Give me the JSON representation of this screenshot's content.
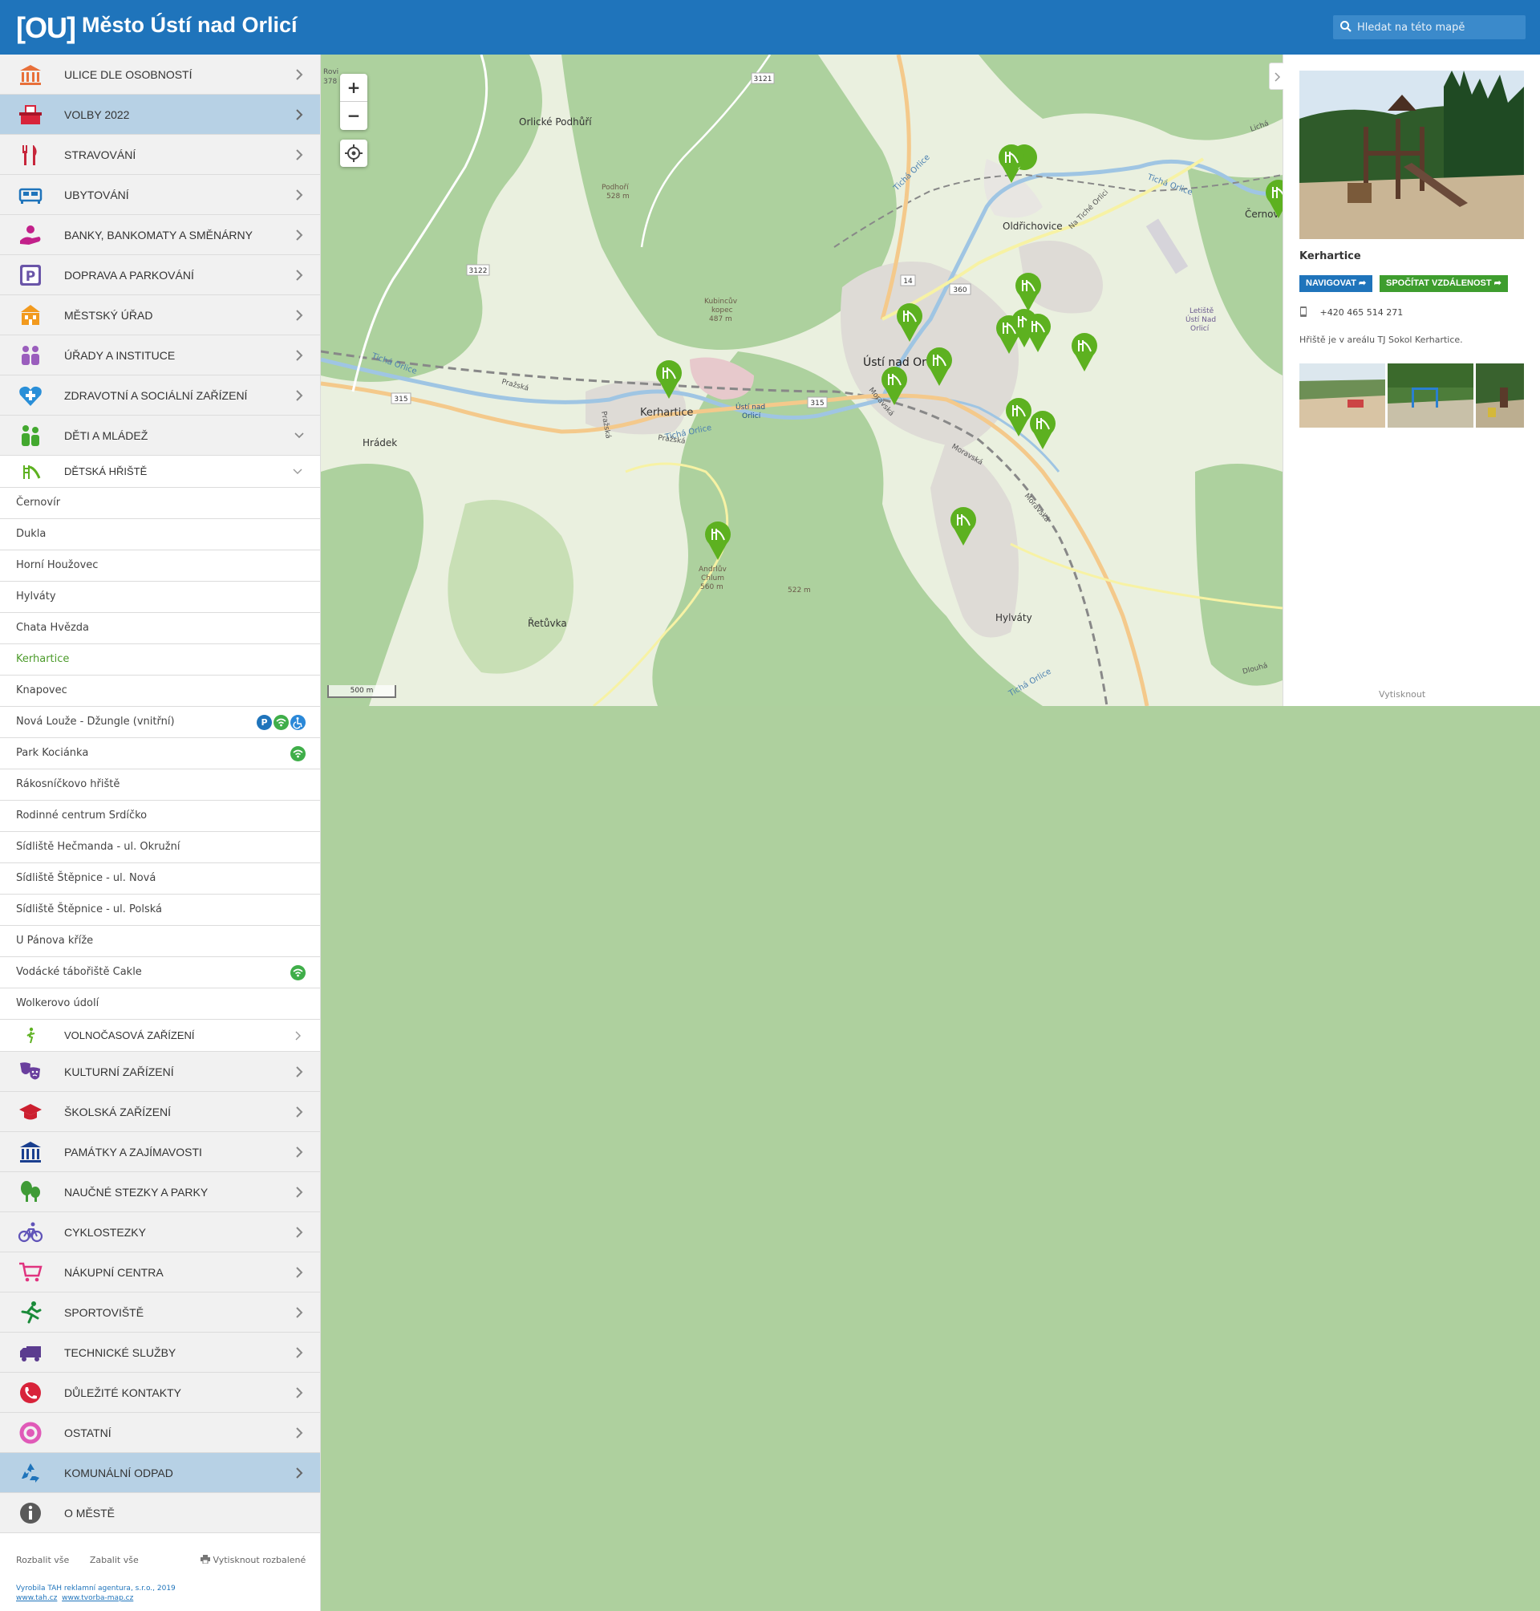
{
  "header": {
    "logo": "[OU]",
    "title": "Město Ústí nad Orlicí",
    "search_placeholder": "Hledat na této mapě"
  },
  "sidebar": {
    "categories_top": [
      {
        "label": "ULICE DLE OSOBNOSTÍ",
        "icon": "monument-icon"
      },
      {
        "label": "VOLBY 2022",
        "icon": "ballot-box-icon"
      },
      {
        "label": "STRAVOVÁNÍ",
        "icon": "fork-knife-icon"
      },
      {
        "label": "UBYTOVÁNÍ",
        "icon": "bed-icon"
      },
      {
        "label": "BANKY, BANKOMATY A SMĚNÁRNY",
        "icon": "coin-hand-icon"
      },
      {
        "label": "DOPRAVA A PARKOVÁNÍ",
        "icon": "parking-icon"
      },
      {
        "label": "MĚSTSKÝ ÚŘAD",
        "icon": "town-hall-icon"
      },
      {
        "label": "ÚŘADY A INSTITUCE",
        "icon": "people-icon"
      },
      {
        "label": "ZDRAVOTNÍ A SOCIÁLNÍ ZAŘÍZENÍ",
        "icon": "heart-cross-icon"
      },
      {
        "label": "DĚTI A MLÁDEŽ",
        "icon": "children-icon"
      }
    ],
    "subcategory": {
      "label": "DĚTSKÁ HŘIŠTĚ",
      "icon": "slide-icon"
    },
    "items": [
      {
        "label": "Černovír"
      },
      {
        "label": "Dukla"
      },
      {
        "label": "Horní Houžovec"
      },
      {
        "label": "Hylváty"
      },
      {
        "label": "Chata Hvězda"
      },
      {
        "label": "Kerhartice"
      },
      {
        "label": "Knapovec"
      },
      {
        "label": "Nová Louže - Džungle (vnitřní)"
      },
      {
        "label": "Park Kociánka"
      },
      {
        "label": "Rákosníčkovo hřiště"
      },
      {
        "label": "Rodinné centrum Srdíčko"
      },
      {
        "label": "Sídliště Hečmanda - ul. Okružní"
      },
      {
        "label": "Sídliště Štěpnice - ul. Nová"
      },
      {
        "label": "Sídliště Štěpnice - ul. Polská"
      },
      {
        "label": "U Pánova kříže"
      },
      {
        "label": "Vodácké tábořiště Cakle"
      },
      {
        "label": "Wolkerovo údolí"
      }
    ],
    "subcategory2": {
      "label": "VOLNOČASOVÁ ZAŘÍZENÍ",
      "icon": "leisure-icon"
    },
    "categories_bottom": [
      {
        "label": "KULTURNÍ ZAŘÍZENÍ",
        "icon": "theater-masks-icon"
      },
      {
        "label": "ŠKOLSKÁ ZAŘÍZENÍ",
        "icon": "graduation-cap-icon"
      },
      {
        "label": "PAMÁTKY A ZAJÍMAVOSTI",
        "icon": "columns-icon"
      },
      {
        "label": "NAUČNÉ STEZKY A PARKY",
        "icon": "trees-icon"
      },
      {
        "label": "CYKLOSTEZKY",
        "icon": "bicycle-icon"
      },
      {
        "label": "NÁKUPNÍ CENTRA",
        "icon": "shopping-cart-icon"
      },
      {
        "label": "SPORTOVIŠTĚ",
        "icon": "runner-icon"
      },
      {
        "label": "TECHNICKÉ SLUŽBY",
        "icon": "truck-icon"
      },
      {
        "label": "DŮLEŽITÉ KONTAKTY",
        "icon": "phone-icon"
      },
      {
        "label": "OSTATNÍ",
        "icon": "circle-icon"
      },
      {
        "label": "KOMUNÁLNÍ ODPAD",
        "icon": "recycle-icon"
      },
      {
        "label": "O MĚSTĚ",
        "icon": "info-icon"
      }
    ],
    "footer": {
      "expand_all": "Rozbalit vše",
      "collapse_all": "Zabalit vše",
      "print_expanded": "Vytisknout rozbalené",
      "credit_line1": "Vyrobila TAH reklamní agentura, s.r.o., 2019",
      "credit_link1": "www.tah.cz",
      "credit_link2": "www.tvorba-map.cz"
    }
  },
  "map": {
    "labels": [
      {
        "text": "Orlické Podhůří"
      },
      {
        "text": "Oldřichovice"
      },
      {
        "text": "Kerhartice"
      },
      {
        "text": "Ústí nad Or"
      },
      {
        "text": "Hrádek"
      },
      {
        "text": "Řetůvka"
      },
      {
        "text": "Hylváty"
      },
      {
        "text": "Černov"
      },
      {
        "text": "Podhoří"
      },
      {
        "text": "528 m"
      },
      {
        "text": "Kubincův"
      },
      {
        "text": "kopec"
      },
      {
        "text": "487 m"
      },
      {
        "text": "Andrlův"
      },
      {
        "text": "Chlum"
      },
      {
        "text": "560 m"
      },
      {
        "text": "522 m"
      },
      {
        "text": "Ústí nad"
      },
      {
        "text": "Orlicí"
      },
      {
        "text": "Letiště"
      },
      {
        "text": "Ústí Nad"
      },
      {
        "text": "Orlicí"
      },
      {
        "text": "Tichá Orlice"
      },
      {
        "text": "Tichá Orlice"
      },
      {
        "text": "Tichá Orlice"
      },
      {
        "text": "Tichá Orlice"
      },
      {
        "text": "Pražská"
      },
      {
        "text": "Pražská"
      },
      {
        "text": "Pražská"
      },
      {
        "text": "Moravská"
      },
      {
        "text": "Moravská"
      },
      {
        "text": "Moravská"
      },
      {
        "text": "Na Tiché Orlici"
      },
      {
        "text": "Rovi"
      },
      {
        "text": "378"
      },
      {
        "text": "Dlouhá"
      },
      {
        "text": "Lichá"
      },
      {
        "text": "Tichá Orlice"
      }
    ],
    "road_numbers": [
      "3121",
      "3122",
      "14",
      "360",
      "315",
      "315"
    ],
    "zoom_in": "+",
    "zoom_out": "−",
    "scale": "500 m",
    "marker_count": 15
  },
  "panel": {
    "title": "Kerhartice",
    "navigate": "NAVIGOVAT",
    "distance": "SPOČÍTAT VZDÁLENOST",
    "phone": "+420 465 514 271",
    "description": "Hřiště je v areálu TJ Sokol Kerhartice.",
    "print": "Vytisknout"
  },
  "colors": {
    "header": "#1f74bb",
    "highlight": "#b7d1e5",
    "marker": "#5db120",
    "active_item": "#4c9b2b"
  }
}
